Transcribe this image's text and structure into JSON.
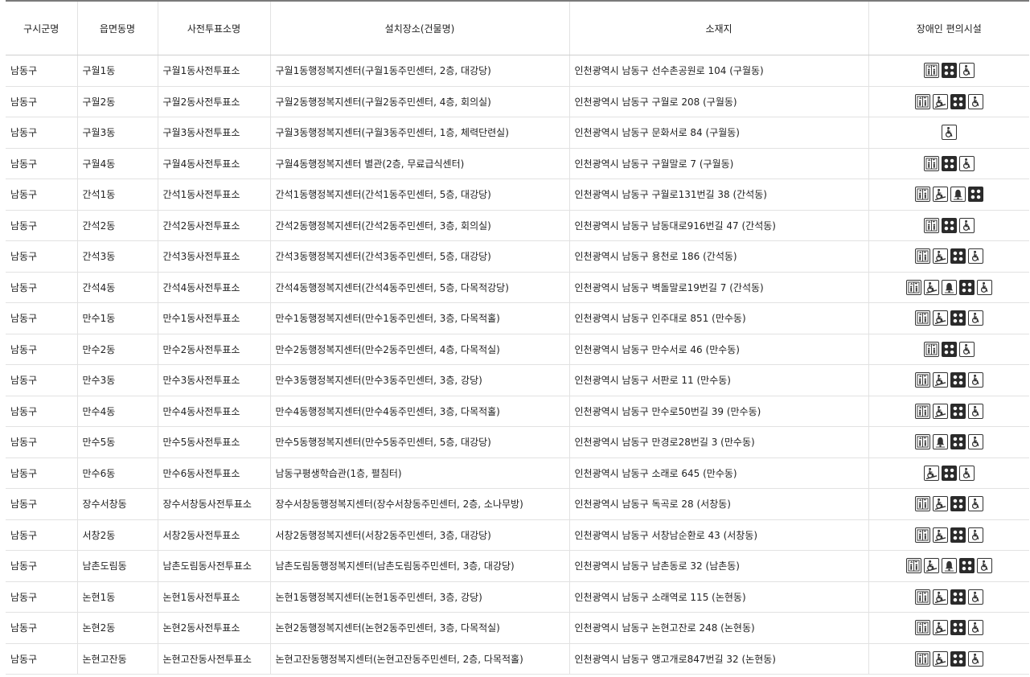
{
  "columns": [
    "구시군명",
    "읍면동명",
    "사전투표소명",
    "설치장소(건물명)",
    "소재지",
    "장애인 편의시설"
  ],
  "rows": [
    {
      "gu": "남동구",
      "dong": "구월1동",
      "station": "구월1동사전투표소",
      "place": "구월1동행정복지센터(구월1동주민센터, 2층, 대강당)",
      "address": "인천광역시 남동구 선수촌공원로 104 (구월동)",
      "facilities": [
        "elevator",
        "braille",
        "wheelchair"
      ]
    },
    {
      "gu": "남동구",
      "dong": "구월2동",
      "station": "구월2동사전투표소",
      "place": "구월2동행정복지센터(구월2동주민센터, 4층, 회의실)",
      "address": "인천광역시 남동구 구월로 208 (구월동)",
      "facilities": [
        "elevator",
        "ramp",
        "braille",
        "wheelchair"
      ]
    },
    {
      "gu": "남동구",
      "dong": "구월3동",
      "station": "구월3동사전투표소",
      "place": "구월3동행정복지센터(구월3동주민센터, 1층, 체력단련실)",
      "address": "인천광역시 남동구 문화서로 84 (구월동)",
      "facilities": [
        "wheelchair"
      ]
    },
    {
      "gu": "남동구",
      "dong": "구월4동",
      "station": "구월4동사전투표소",
      "place": "구월4동행정복지센터 별관(2층, 무료급식센터)",
      "address": "인천광역시 남동구 구월말로 7 (구월동)",
      "facilities": [
        "elevator",
        "braille",
        "wheelchair"
      ]
    },
    {
      "gu": "남동구",
      "dong": "간석1동",
      "station": "간석1동사전투표소",
      "place": "간석1동행정복지센터(간석1동주민센터, 5층, 대강당)",
      "address": "인천광역시 남동구 구월로131번길 38 (간석동)",
      "facilities": [
        "elevator",
        "ramp",
        "bell",
        "braille"
      ]
    },
    {
      "gu": "남동구",
      "dong": "간석2동",
      "station": "간석2동사전투표소",
      "place": "간석2동행정복지센터(간석2동주민센터, 3층, 회의실)",
      "address": "인천광역시 남동구 남동대로916번길 47 (간석동)",
      "facilities": [
        "elevator",
        "braille",
        "wheelchair"
      ]
    },
    {
      "gu": "남동구",
      "dong": "간석3동",
      "station": "간석3동사전투표소",
      "place": "간석3동행정복지센터(간석3동주민센터, 5층, 대강당)",
      "address": "인천광역시 남동구 용천로 186 (간석동)",
      "facilities": [
        "elevator",
        "ramp",
        "braille",
        "wheelchair"
      ]
    },
    {
      "gu": "남동구",
      "dong": "간석4동",
      "station": "간석4동사전투표소",
      "place": "간석4동행정복지센터(간석4동주민센터, 5층, 다목적강당)",
      "address": "인천광역시 남동구 벽돌말로19번길 7 (간석동)",
      "facilities": [
        "elevator",
        "ramp",
        "bell",
        "braille",
        "wheelchair"
      ]
    },
    {
      "gu": "남동구",
      "dong": "만수1동",
      "station": "만수1동사전투표소",
      "place": "만수1동행정복지센터(만수1동주민센터, 3층, 다목적홀)",
      "address": "인천광역시 남동구 인주대로 851 (만수동)",
      "facilities": [
        "elevator",
        "ramp",
        "braille",
        "wheelchair"
      ]
    },
    {
      "gu": "남동구",
      "dong": "만수2동",
      "station": "만수2동사전투표소",
      "place": "만수2동행정복지센터(만수2동주민센터, 4층, 다목적실)",
      "address": "인천광역시 남동구 만수서로 46 (만수동)",
      "facilities": [
        "elevator",
        "braille",
        "wheelchair"
      ]
    },
    {
      "gu": "남동구",
      "dong": "만수3동",
      "station": "만수3동사전투표소",
      "place": "만수3동행정복지센터(만수3동주민센터, 3층, 강당)",
      "address": "인천광역시 남동구 서판로 11 (만수동)",
      "facilities": [
        "elevator",
        "ramp",
        "braille",
        "wheelchair"
      ]
    },
    {
      "gu": "남동구",
      "dong": "만수4동",
      "station": "만수4동사전투표소",
      "place": "만수4동행정복지센터(만수4동주민센터, 3층, 다목적홀)",
      "address": "인천광역시 남동구 만수로50번길 39 (만수동)",
      "facilities": [
        "elevator",
        "ramp",
        "braille",
        "wheelchair"
      ]
    },
    {
      "gu": "남동구",
      "dong": "만수5동",
      "station": "만수5동사전투표소",
      "place": "만수5동행정복지센터(만수5동주민센터, 5층, 대강당)",
      "address": "인천광역시 남동구 만경로28번길 3 (만수동)",
      "facilities": [
        "elevator",
        "bell",
        "braille",
        "wheelchair"
      ]
    },
    {
      "gu": "남동구",
      "dong": "만수6동",
      "station": "만수6동사전투표소",
      "place": "남동구평생학습관(1층, 펼침터)",
      "address": "인천광역시 남동구 소래로 645 (만수동)",
      "facilities": [
        "ramp",
        "braille",
        "wheelchair"
      ]
    },
    {
      "gu": "남동구",
      "dong": "장수서창동",
      "station": "장수서창동사전투표소",
      "place": "장수서창동행정복지센터(장수서창동주민센터, 2층, 소나무방)",
      "address": "인천광역시 남동구 독곡로 28 (서창동)",
      "facilities": [
        "elevator",
        "ramp",
        "braille",
        "wheelchair"
      ]
    },
    {
      "gu": "남동구",
      "dong": "서창2동",
      "station": "서창2동사전투표소",
      "place": "서창2동행정복지센터(서창2동주민센터, 3층, 대강당)",
      "address": "인천광역시 남동구 서창남순환로 43 (서창동)",
      "facilities": [
        "elevator",
        "ramp",
        "braille",
        "wheelchair"
      ]
    },
    {
      "gu": "남동구",
      "dong": "남촌도림동",
      "station": "남촌도림동사전투표소",
      "place": "남촌도림동행정복지센터(남촌도림동주민센터, 3층, 대강당)",
      "address": "인천광역시 남동구 남촌동로 32 (남촌동)",
      "facilities": [
        "elevator",
        "ramp",
        "bell",
        "braille",
        "wheelchair"
      ]
    },
    {
      "gu": "남동구",
      "dong": "논현1동",
      "station": "논현1동사전투표소",
      "place": "논현1동행정복지센터(논현1동주민센터, 3층, 강당)",
      "address": "인천광역시 남동구 소래역로 115 (논현동)",
      "facilities": [
        "elevator",
        "ramp",
        "braille",
        "wheelchair"
      ]
    },
    {
      "gu": "남동구",
      "dong": "논현2동",
      "station": "논현2동사전투표소",
      "place": "논현2동행정복지센터(논현2동주민센터, 3층, 다목적실)",
      "address": "인천광역시 남동구 논현고잔로 248 (논현동)",
      "facilities": [
        "elevator",
        "ramp",
        "braille",
        "wheelchair"
      ]
    },
    {
      "gu": "남동구",
      "dong": "논현고잔동",
      "station": "논현고잔동사전투표소",
      "place": "논현고잔동행정복지센터(논현고잔동주민센터, 2층, 다목적홀)",
      "address": "인천광역시 남동구 앵고개로847번길 32 (논현동)",
      "facilities": [
        "elevator",
        "ramp",
        "braille",
        "wheelchair"
      ]
    }
  ]
}
